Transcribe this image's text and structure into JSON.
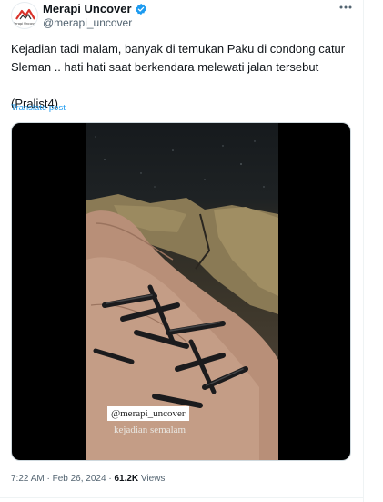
{
  "author": {
    "display_name": "Merapi Uncover",
    "handle": "@merapi_uncover",
    "avatar_text": "Merapi Uncover"
  },
  "tweet": {
    "text": "Kejadian tadi malam, banyak di temukan Paku di condong catur\nSleman .. hati hati saat berkendara melewati jalan tersebut\n\n(Pralist4)",
    "translate_label": "Translate post"
  },
  "media": {
    "overlay_handle": "@merapi_uncover",
    "overlay_caption": "kejadian semalam"
  },
  "meta": {
    "time": "7:22 AM",
    "separator": "·",
    "date": "Feb 26, 2024",
    "views_count": "61.2K",
    "views_label": "Views"
  },
  "colors": {
    "accent": "#1d9bf0",
    "text": "#0f1419",
    "secondary": "#536471"
  }
}
